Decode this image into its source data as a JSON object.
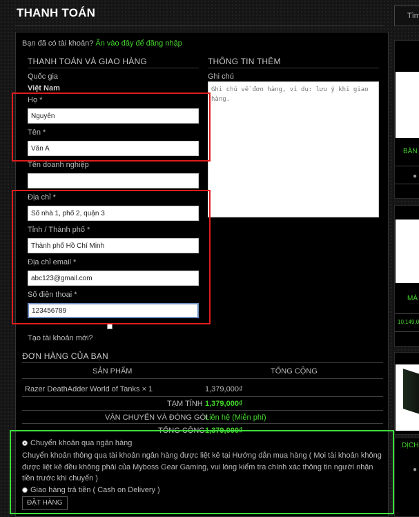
{
  "page": {
    "title": "THANH TOÁN"
  },
  "login_prompt": {
    "text": "Bạn đã có tài khoản?",
    "link": "Ấn vào đây để đăng nhập"
  },
  "billing": {
    "heading": "THANH TOÁN VÀ GIAO HÀNG",
    "country_label": "Quốc gia",
    "country_value": "Việt Nam",
    "last_name_label": "Họ *",
    "last_name_value": "Nguyễn",
    "first_name_label": "Tên *",
    "first_name_value": "Văn A",
    "company_label": "Tên doanh nghiệp",
    "company_value": "",
    "address_label": "Địa chỉ *",
    "address_value": "Số nhà 1, phố 2, quận 3",
    "city_label": "Tỉnh / Thành phố *",
    "city_value": "Thành phố Hồ Chí Minh",
    "email_label": "Địa chỉ email *",
    "email_value": "abc123@gmail.com",
    "phone_label": "Số điện thoại *",
    "phone_value": "123456789",
    "create_account_label": "Tạo tài khoản mới?"
  },
  "additional": {
    "heading": "THÔNG TIN THÊM",
    "notes_label": "Ghi chú",
    "notes_placeholder": "Ghi chú về đơn hàng, ví dụ: lưu ý khi giao hàng."
  },
  "order": {
    "heading": "ĐƠN HÀNG CỦA BẠN",
    "col_product": "SẢN PHẨM",
    "col_total": "TỔNG CỘNG",
    "items": [
      {
        "name": "Razer DeathAdder World of Tanks × 1",
        "total": "1,379,000₫"
      }
    ],
    "subtotal_label": "TẠM TÍNH",
    "subtotal_value": "1,379,000₫",
    "shipping_label": "VẬN CHUYỂN VÀ ĐÓNG GÓI",
    "shipping_value": "Liên hệ (Miễn phí)",
    "total_label": "TỔNG CỘNG",
    "total_value": "1,379,000₫"
  },
  "payment": {
    "bank_label": "Chuyển khoản qua ngân hàng",
    "bank_desc_1": "Chuyển khoản thông qua tài khoản ngân hàng được liệt kê tại Hướng dẫn mua hàng ( Mọi tài khoản không",
    "bank_desc_2": "được liệt kê đều không phải của Myboss Gear Gaming, vui lòng kiểm tra chính xác thông tin người nhận",
    "bank_desc_3": "tiền trước khi chuyển )",
    "cod_label": "Giao hàng trả tiền ( Cash on Delivery )",
    "place_order": "ĐẶT HÀNG",
    "bank_selected": true
  },
  "sidebar": {
    "search_placeholder": "Tìm",
    "item1_text": "BÀN",
    "item2_text": "MÁ",
    "item2_price": "10,149,0",
    "item3_text": "DỊCH"
  },
  "colors": {
    "accent_green": "#44d62c",
    "annotation_red": "#e01c1c",
    "annotation_green": "#3be03b"
  }
}
